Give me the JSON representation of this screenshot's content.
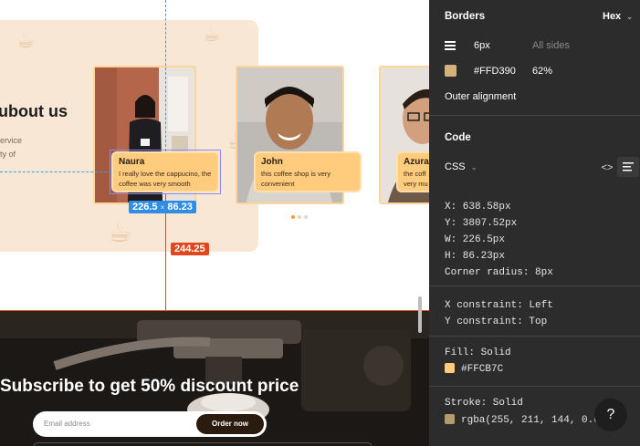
{
  "canvas": {
    "about_title": "ubout us",
    "about_text_1": "ervice",
    "about_text_2": "ty of",
    "testimonials": [
      {
        "name": "Naura",
        "text": "I really love the cappucino, the coffee was very smooth"
      },
      {
        "name": "John",
        "text": "this coffee shop is very convenient"
      },
      {
        "name": "Azura",
        "text": "the coff very mu"
      }
    ],
    "measure_w": "226.5",
    "measure_sep": "×",
    "measure_h": "86.23",
    "distance_label": "244.25",
    "subscribe_title": "Subscribe to get 50% discount price",
    "email_placeholder": "Email address",
    "order_button": "Order now"
  },
  "panel": {
    "borders_title": "Borders",
    "color_format": "Hex",
    "border_width": "6px",
    "border_sides": "All sides",
    "border_color": "#FFD390",
    "border_opacity": "62%",
    "outer_alignment": "Outer alignment",
    "code_title": "Code",
    "code_language": "CSS",
    "code_lines": [
      "X: 638.58px",
      "Y: 3807.52px",
      "W: 226.5px",
      "H: 86.23px",
      "Corner radius: 8px"
    ],
    "constraint_lines": [
      "X constraint: Left",
      "Y constraint: Top"
    ],
    "fill_label": "Fill: Solid",
    "fill_value": "#FFCB7C",
    "stroke_label": "Stroke: Solid",
    "stroke_value": "rgba(255, 211, 144, 0.6",
    "help": "?"
  },
  "colors": {
    "fill": "#FFCB7C",
    "stroke": "#B59A6E",
    "border_swatch": "#FFD390",
    "measure_blue": "#2f8de4",
    "distance_red": "#e2461e"
  }
}
